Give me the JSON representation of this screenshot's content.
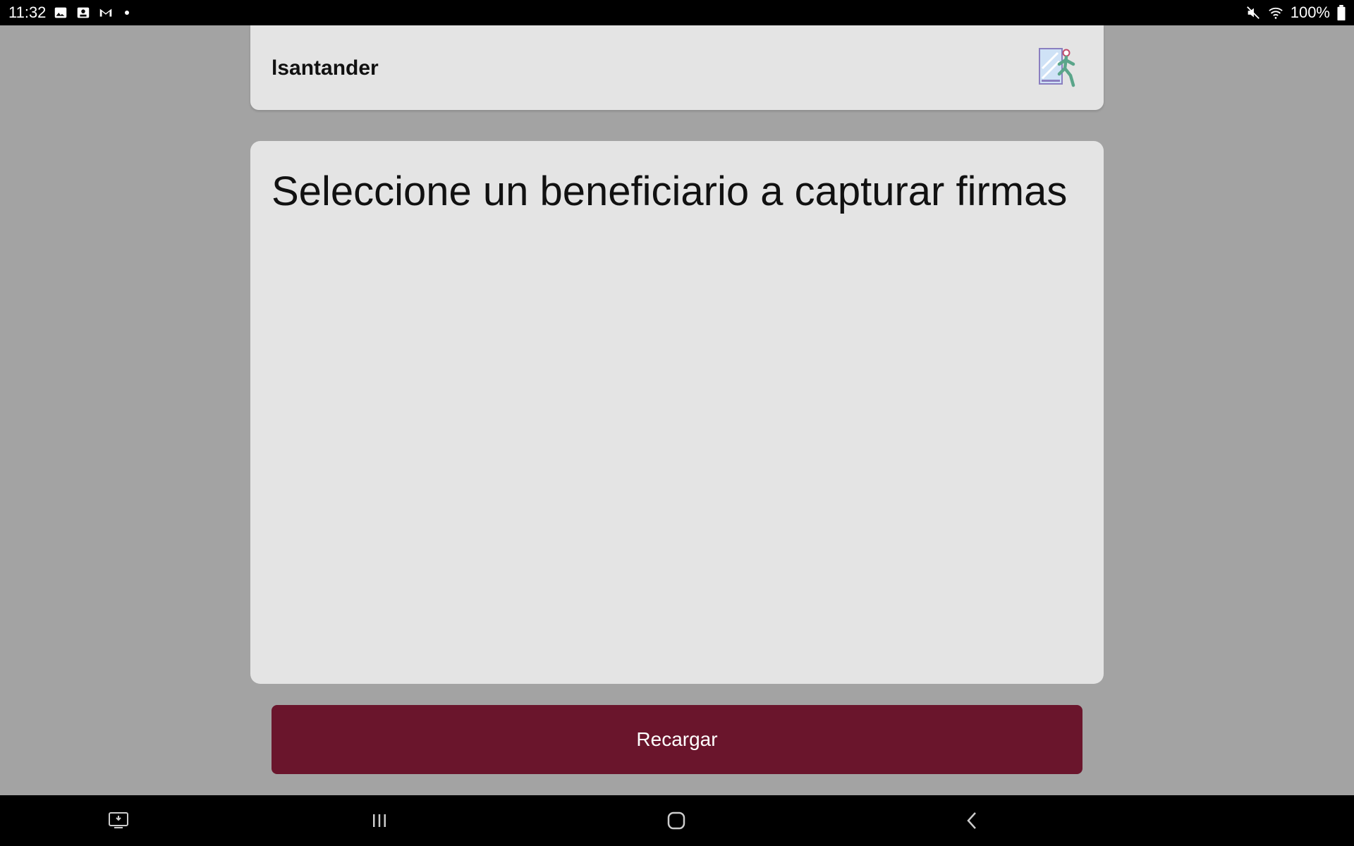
{
  "status_bar": {
    "time": "11:32",
    "battery": "100%",
    "left_icons": [
      "gallery-icon",
      "screenshot-icon",
      "gmail-icon"
    ],
    "right_icons": [
      "mute-icon",
      "wifi-icon",
      "battery-icon"
    ]
  },
  "header": {
    "username": "lsantander",
    "exit_icon": "exit-door-icon"
  },
  "content": {
    "prompt": "Seleccione un beneficiario a capturar firmas"
  },
  "actions": {
    "reload_label": "Recargar"
  },
  "nav_bar": {
    "icons": [
      "screen-share-icon",
      "recent-apps-icon",
      "home-icon",
      "back-icon"
    ]
  },
  "colors": {
    "background": "#a3a3a3",
    "card": "#e4e4e4",
    "accent": "#6a152c"
  }
}
